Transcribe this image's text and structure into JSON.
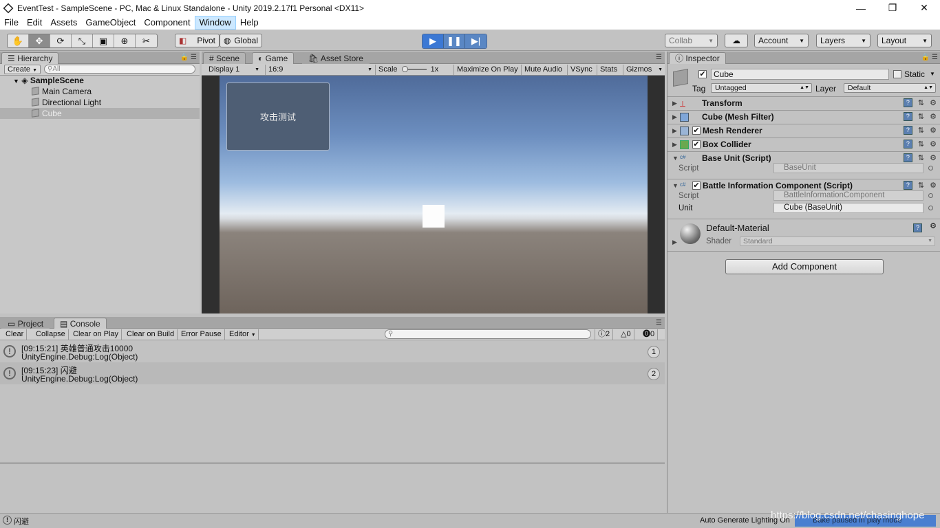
{
  "window": {
    "title": "EventTest - SampleScene - PC, Mac & Linux Standalone - Unity 2019.2.17f1 Personal <DX11>",
    "controls": [
      "—",
      "❐",
      "✕"
    ]
  },
  "menubar": [
    "File",
    "Edit",
    "Assets",
    "GameObject",
    "Component",
    "Window",
    "Help"
  ],
  "toolbar": {
    "tools": [
      "✋",
      "✥",
      "⟳",
      "⤡",
      "▣",
      "⊕",
      "✂"
    ],
    "pivot": "Pivot",
    "global": "Global",
    "collab": "Collab",
    "account": "Account",
    "layers": "Layers",
    "layout": "Layout"
  },
  "hierarchy": {
    "tab": "Hierarchy",
    "create": "Create",
    "search_placeholder": "All",
    "scene": "SampleScene",
    "items": [
      "Main Camera",
      "Directional Light",
      "Cube"
    ]
  },
  "center_tabs": {
    "scene": "Scene",
    "game": "Game",
    "asset_store": "Asset Store"
  },
  "game_controls": {
    "display": "Display 1",
    "aspect": "16:9",
    "scale_label": "Scale",
    "scale_value": "1x",
    "maximize": "Maximize On Play",
    "mute": "Mute Audio",
    "vsync": "VSync",
    "stats": "Stats",
    "gizmos": "Gizmos"
  },
  "game_view": {
    "button_text": "攻击测试"
  },
  "inspector": {
    "tab": "Inspector",
    "object_name": "Cube",
    "static": "Static",
    "tag_label": "Tag",
    "tag_value": "Untagged",
    "layer_label": "Layer",
    "layer_value": "Default",
    "components": [
      {
        "name": "Transform"
      },
      {
        "name": "Cube (Mesh Filter)"
      },
      {
        "name": "Mesh Renderer"
      },
      {
        "name": "Box Collider"
      },
      {
        "name": "Base Unit (Script)"
      },
      {
        "name": "Battle Information Component (Script)"
      }
    ],
    "base_unit": {
      "script_label": "Script",
      "script_value": "BaseUnit"
    },
    "battle_info": {
      "script_label": "Script",
      "script_value": "BattleInformationComponent",
      "unit_label": "Unit",
      "unit_value": "Cube (BaseUnit)"
    },
    "material": {
      "name": "Default-Material",
      "shader_label": "Shader",
      "shader_value": "Standard"
    },
    "add_component": "Add Component"
  },
  "console": {
    "tabs": [
      "Project",
      "Console"
    ],
    "buttons": [
      "Clear",
      "Collapse",
      "Clear on Play",
      "Clear on Build",
      "Error Pause",
      "Editor"
    ],
    "counts": {
      "info": "2",
      "warn": "0",
      "error": "0"
    },
    "logs": [
      {
        "line1": "[09:15:21] 英雄普通攻击10000",
        "line2": "UnityEngine.Debug:Log(Object)",
        "count": "1"
      },
      {
        "line1": "[09:15:23] 闪避",
        "line2": "UnityEngine.Debug:Log(Object)",
        "count": "2"
      }
    ]
  },
  "statusbar": {
    "message": "闪避",
    "auto_generate": "Auto Generate Lighting On",
    "bake": "Bake paused in play mode",
    "watermark": "https://blog.csdn.net/chasinghope"
  },
  "colors": {
    "play_active": "#3b78d4",
    "selected_row": "#b0b0b0",
    "game_button": "#4e5e74"
  }
}
